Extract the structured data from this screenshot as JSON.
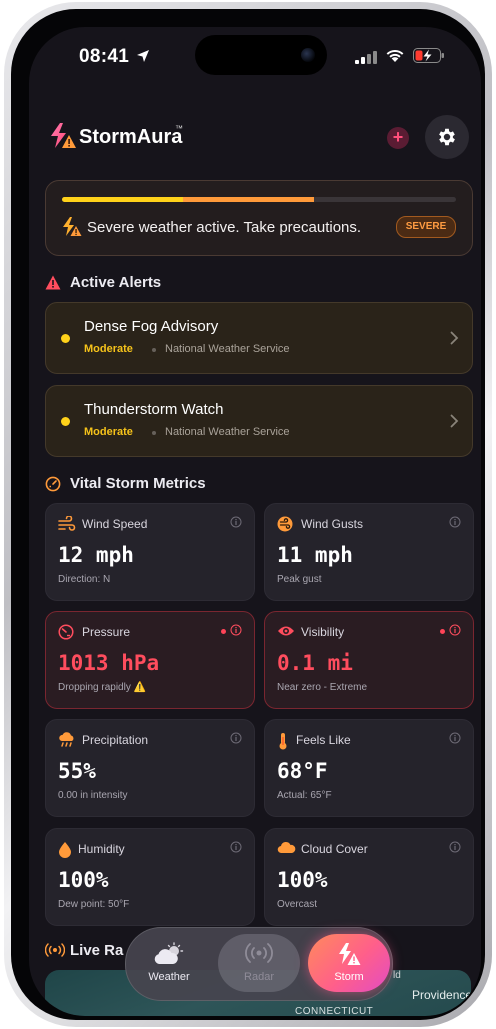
{
  "status_bar": {
    "time": "08:41"
  },
  "header": {
    "app_name": "StormAura",
    "trademark": "™",
    "add_label": "+"
  },
  "banner": {
    "text": "Severe weather active. Take precautions.",
    "badge": "SEVERE",
    "progress": 0.64
  },
  "sections": {
    "alerts": "Active Alerts",
    "metrics": "Vital Storm Metrics",
    "radar": "Live Ra"
  },
  "alerts": [
    {
      "title": "Dense Fog Advisory",
      "severity": "Moderate",
      "source": "National Weather Service"
    },
    {
      "title": "Thunderstorm Watch",
      "severity": "Moderate",
      "source": "National Weather Service"
    }
  ],
  "metrics": [
    {
      "label": "Wind Speed",
      "value": "12 mph",
      "sub": "Direction: N",
      "icon": "wind-icon"
    },
    {
      "label": "Wind Gusts",
      "value": "11 mph",
      "sub": "Peak gust",
      "icon": "gust-icon"
    },
    {
      "label": "Pressure",
      "value": "1013 hPa",
      "sub": "Dropping rapidly ⚠️",
      "icon": "gauge-icon"
    },
    {
      "label": "Visibility",
      "value": "0.1 mi",
      "sub": "Near zero - Extreme",
      "icon": "eye-icon"
    },
    {
      "label": "Precipitation",
      "value": "55%",
      "sub": "0.00 in intensity",
      "icon": "rain-cloud-icon"
    },
    {
      "label": "Feels Like",
      "value": "68°F",
      "sub": "Actual: 65°F",
      "icon": "thermometer-icon"
    },
    {
      "label": "Humidity",
      "value": "100%",
      "sub": "Dew point: 50°F",
      "icon": "droplet-icon"
    },
    {
      "label": "Cloud Cover",
      "value": "100%",
      "sub": "Overcast",
      "icon": "cloud-icon"
    }
  ],
  "map": {
    "label_connecticut": "CONNECTICUT",
    "label_providence": "Providence",
    "label_top": "ld"
  },
  "tabs": [
    {
      "label": "Weather",
      "icon": "partly-cloudy-icon"
    },
    {
      "label": "Radar",
      "icon": "radar-waves-icon"
    },
    {
      "label": "Storm",
      "icon": "storm-warning-icon"
    }
  ],
  "colors": {
    "accent": "#ff9a3a",
    "warning": "#ffd21a",
    "danger": "#ff4d5e",
    "background": "#16141b"
  }
}
